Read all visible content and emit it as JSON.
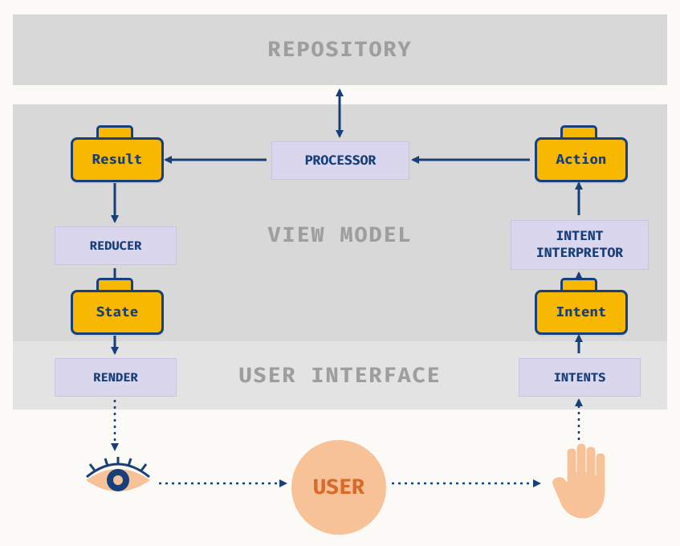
{
  "regions": {
    "repository": "REPOSITORY",
    "viewmodel": "VIEW MODEL",
    "ui": "USER INTERFACE"
  },
  "boxes": {
    "processor": "PROCESSOR",
    "reducer": "REDUCER",
    "intent_interpretor": "INTENT\nINTERPRETOR",
    "render": "RENDER",
    "intents": "INTENTS"
  },
  "data": {
    "result": "Result",
    "action": "Action",
    "state": "State",
    "intent": "Intent"
  },
  "actor": {
    "user": "USER"
  },
  "colors": {
    "band": "#d8d8d8",
    "band_light": "#e3e3e3",
    "proc_bg": "#dad6ed",
    "case_bg": "#f8b700",
    "stroke": "#173f7a",
    "skin": "#f7c297",
    "user_text": "#d96a2a",
    "band_label": "#9e9e9e"
  }
}
